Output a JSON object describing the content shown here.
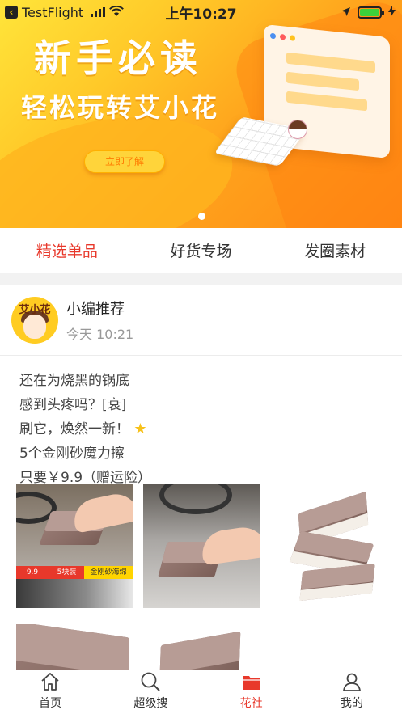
{
  "status_bar": {
    "back_app": "TestFlight",
    "time": "上午10:27",
    "colors": {
      "battery": "#3bd13b"
    }
  },
  "banner": {
    "title": "新手必读",
    "subtitle": "轻松玩转艾小花",
    "button": "立即了解",
    "page_indicator": "1"
  },
  "tabs": [
    {
      "label": "精选单品",
      "active": true
    },
    {
      "label": "好货专场",
      "active": false
    },
    {
      "label": "发圈素材",
      "active": false
    }
  ],
  "post": {
    "avatar_text": "艾小花",
    "author": "小编推荐",
    "time": "今天 10:21",
    "lines": [
      "还在为烧黑的锅底",
      "感到头疼吗？[衰]",
      "刷它，焕然一新！",
      "5个金刚砂魔力擦",
      "只要￥9.9（赠运险）"
    ],
    "image_labels": [
      "9.9",
      "5块装",
      "金刚砂海绵"
    ]
  },
  "tabbar": [
    {
      "label": "首页",
      "icon": "home-icon",
      "active": false
    },
    {
      "label": "超级搜",
      "icon": "search-icon",
      "active": false
    },
    {
      "label": "花社",
      "icon": "folder-icon",
      "active": true
    },
    {
      "label": "我的",
      "icon": "user-icon",
      "active": false
    }
  ],
  "colors": {
    "accent": "#e8382b",
    "banner_yellow": "#ffd400",
    "banner_orange": "#ff8a15"
  }
}
